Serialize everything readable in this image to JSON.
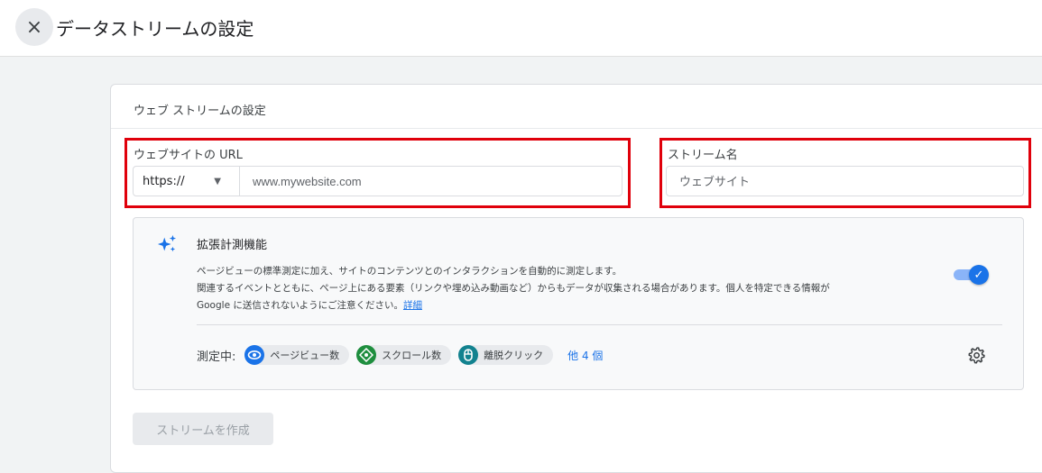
{
  "header": {
    "close_icon": "×",
    "title": "データストリームの設定"
  },
  "card": {
    "title": "ウェブ ストリームの設定"
  },
  "url_field": {
    "label": "ウェブサイトの URL",
    "protocol": "https://",
    "placeholder": "www.mywebsite.com"
  },
  "name_field": {
    "label": "ストリーム名",
    "placeholder": "ウェブサイト"
  },
  "enhanced": {
    "title": "拡張計測機能",
    "desc_line1": "ページビューの標準測定に加え、サイトのコンテンツとのインタラクションを自動的に測定します。",
    "desc_line2": "関連するイベントとともに、ページ上にある要素（リンクや埋め込み動画など）からもデータが収集される場合があります。個人を特定できる情報が",
    "desc_line3": "Google に送信されないようにご注意ください。",
    "details_link": "詳細",
    "toggle_on": true,
    "measuring_label": "測定中:",
    "chips": [
      {
        "label": "ページビュー数",
        "icon": "eye-icon",
        "color": "#1a73e8"
      },
      {
        "label": "スクロール数",
        "icon": "scroll-icon",
        "color": "#1e8e3e"
      },
      {
        "label": "離脱クリック",
        "icon": "mouse-icon",
        "color": "#12828f"
      }
    ],
    "more_link": "他 4 個"
  },
  "create_button": "ストリームを作成",
  "colors": {
    "accent": "#1a73e8",
    "highlight": "#e0000b"
  }
}
